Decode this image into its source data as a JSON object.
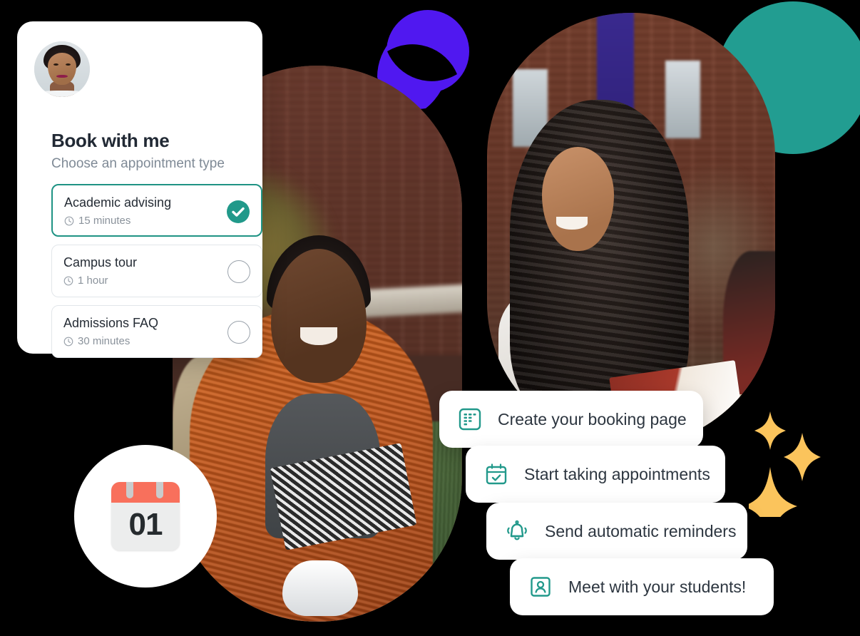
{
  "booking_card": {
    "avatar_name": "avatar",
    "title": "Book with me",
    "subtitle": "Choose an appointment type",
    "options": [
      {
        "name": "Academic advising",
        "duration": "15 minutes",
        "selected": true,
        "icon": "clock-icon"
      },
      {
        "name": "Campus tour",
        "duration": "1 hour",
        "selected": false,
        "icon": "clock-icon"
      },
      {
        "name": "Admissions FAQ",
        "duration": "30 minutes",
        "selected": false,
        "icon": "clock-icon"
      }
    ]
  },
  "feature_pills": [
    {
      "label": "Create your booking page",
      "icon": "booking-form-icon"
    },
    {
      "label": "Start taking appointments",
      "icon": "calendar-check-icon"
    },
    {
      "label": "Send automatic reminders",
      "icon": "bell-ringing-icon"
    },
    {
      "label": "Meet with your students!",
      "icon": "person-card-icon"
    }
  ],
  "calendar_badge": {
    "day": "01",
    "icon": "calendar-emoji-icon"
  },
  "decor": {
    "purple_blob": "purple-blob-shape",
    "teal_circle": "teal-circle-shape",
    "sparkles": "sparkle-stars"
  },
  "photos": [
    {
      "name": "student-writing-photo"
    },
    {
      "name": "student-reading-photo"
    }
  ],
  "colors": {
    "background": "#000000",
    "purple": "#5018f0",
    "teal": "#229d91",
    "accent_teal": "#21998a",
    "sparkle_amber": "#fbc45c",
    "card_white": "#ffffff",
    "calendar_red": "#f8705c",
    "text_dark": "#212934",
    "text_muted": "#7f8a96"
  }
}
